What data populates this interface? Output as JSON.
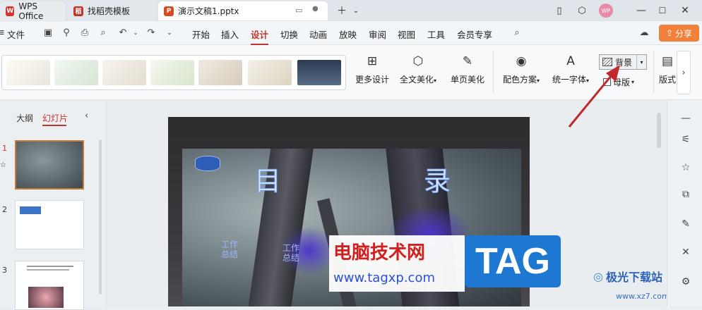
{
  "tabs": {
    "wps": "WPS Office",
    "template": "找稻壳模板",
    "doc": "演示文稿1.pptx"
  },
  "user_avatar": "WP",
  "menu": {
    "file": "文件",
    "items": [
      "开始",
      "插入",
      "设计",
      "切换",
      "动画",
      "放映",
      "审阅",
      "视图",
      "工具",
      "会员专享"
    ],
    "active": "设计",
    "share": "分享"
  },
  "ribbon": {
    "more_design": "更多设计",
    "full_beautify": "全文美化",
    "single_beautify": "单页美化",
    "color_scheme": "配色方案",
    "unify_font": "统一字体",
    "background": "背景",
    "master": "母版",
    "layout": "版式"
  },
  "panel": {
    "outline": "大纲",
    "slides": "幻灯片",
    "slide_numbers": [
      "1",
      "2",
      "3"
    ]
  },
  "slide": {
    "left_char": "目",
    "right_char": "录",
    "item1": "工作\n总结",
    "item2": "工作\n总结"
  },
  "watermark": {
    "site_title": "电脑技术网",
    "site_url": "www.tagxp.com",
    "tag": "TAG",
    "brand": "极光下载站",
    "brand_url": "www.xz7.com"
  },
  "colors": {
    "accent": "#c2362a",
    "share_bg": "#f0803a",
    "tag_blue": "#1e78d2",
    "arrow": "#c0282b"
  }
}
